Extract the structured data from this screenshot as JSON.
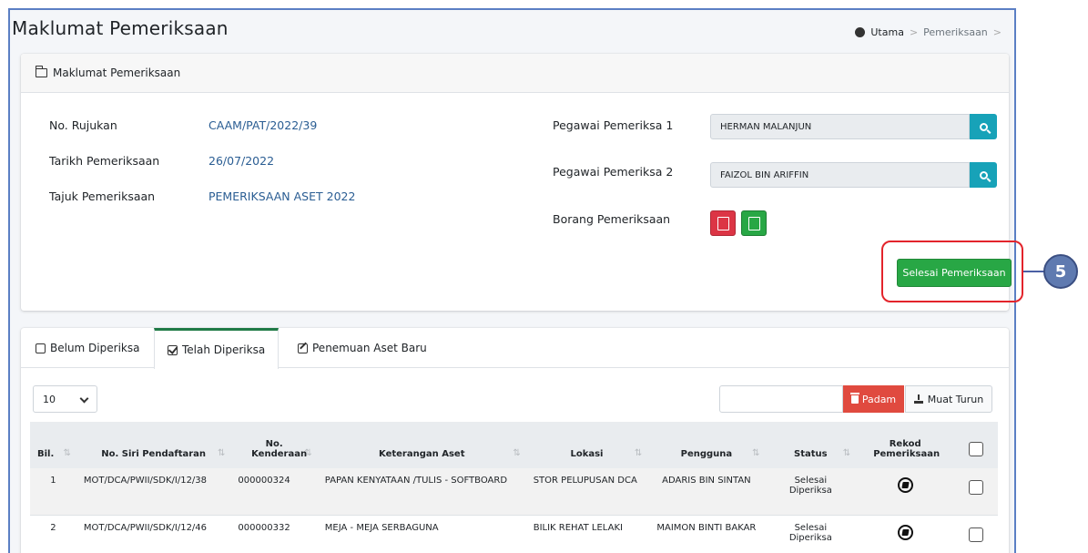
{
  "header": {
    "title": "Maklumat Pemeriksaan",
    "breadcrumb": {
      "home": "Utama",
      "sep": ">",
      "current": "Pemeriksaan",
      "trail_sep": ">"
    }
  },
  "info_card": {
    "title": "Maklumat Pemeriksaan",
    "fields": [
      {
        "label": "No. Rujukan",
        "value": "CAAM/PAT/2022/39"
      },
      {
        "label": "Tarikh Pemeriksaan",
        "value": "26/07/2022"
      },
      {
        "label": "Tajuk Pemeriksaan",
        "value": "PEMERIKSAAN ASET 2022"
      }
    ],
    "officer1": {
      "label": "Pegawai Pemeriksa 1",
      "value": "HERMAN MALANJUN"
    },
    "officer2": {
      "label": "Pegawai Pemeriksa 2",
      "value": "FAIZOL BIN ARIFFIN"
    },
    "form": {
      "label": "Borang Pemeriksaan"
    },
    "finish_button": "Selesai Pemeriksaan"
  },
  "tabs": [
    {
      "label": "Belum Diperiksa"
    },
    {
      "label": "Telah Diperiksa"
    },
    {
      "label": "Penemuan Aset Baru"
    }
  ],
  "toolbar": {
    "page_length": "10",
    "search_value": "",
    "delete_label": "Padam",
    "download_label": "Muat Turun"
  },
  "table": {
    "headers": [
      "Bil.",
      "No. Siri Pendaftaran",
      "No. Kenderaan",
      "Keterangan Aset",
      "Lokasi",
      "Pengguna",
      "Status",
      "Rekod Pemeriksaan"
    ],
    "rows": [
      {
        "bil": "1",
        "siri": "MOT/DCA/PWII/SDK/I/12/38",
        "kenderaan": "000000324",
        "keterangan": "PAPAN KENYATAAN /TULIS - SOFTBOARD",
        "lokasi": "STOR PELUPUSAN DCA",
        "pengguna": "ADARIS BIN SINTAN",
        "status": "Selesai Diperiksa"
      },
      {
        "bil": "2",
        "siri": "MOT/DCA/PWII/SDK/I/12/46",
        "kenderaan": "000000332",
        "keterangan": "MEJA - MEJA SERBAGUNA",
        "lokasi": "BILIK REHAT LELAKI",
        "pengguna": "MAIMON BINTI BAKAR",
        "status": "Selesai Diperiksa"
      }
    ]
  },
  "callout": {
    "number": "5"
  },
  "colors": {
    "accent_blue": "#17a2b8",
    "success": "#28a745",
    "danger": "#dc3545",
    "link": "#2a5d93",
    "callout_red": "#e3242b"
  }
}
